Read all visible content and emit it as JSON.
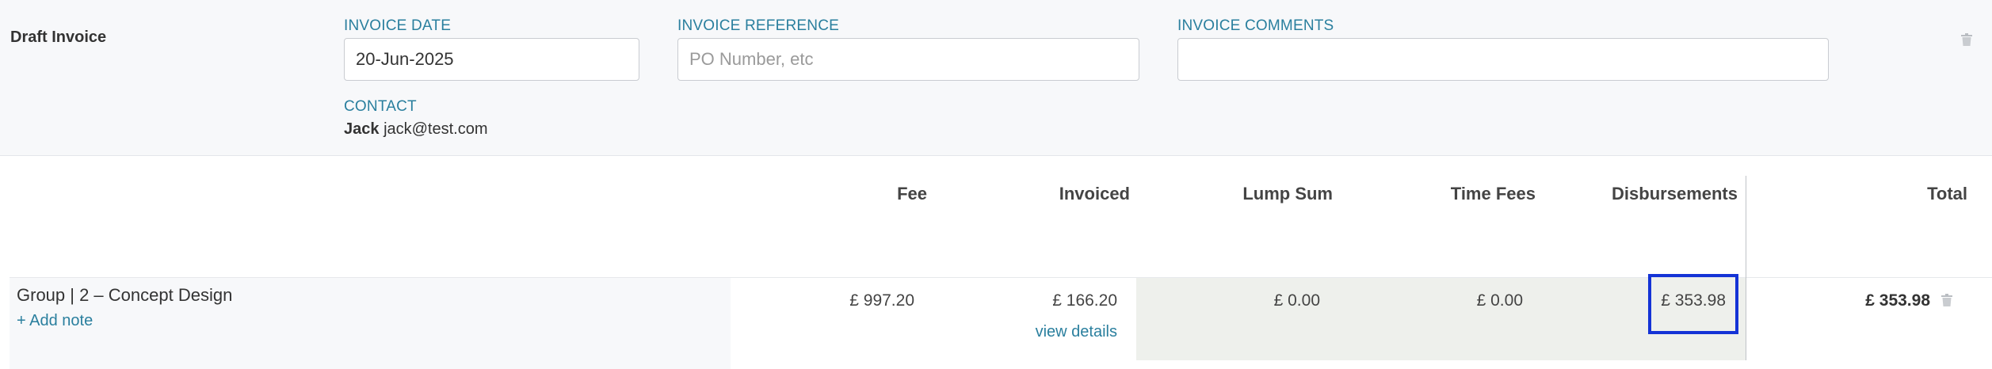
{
  "header": {
    "title": "Draft Invoice",
    "invoice_date_label": "INVOICE DATE",
    "invoice_date_value": "20-Jun-2025",
    "invoice_reference_label": "INVOICE REFERENCE",
    "invoice_reference_placeholder": "PO Number, etc",
    "invoice_comments_label": "INVOICE COMMENTS",
    "invoice_comments_value": "",
    "contact_label": "CONTACT",
    "contact_name": "Jack",
    "contact_email": "jack@test.com",
    "delete_icon": "trash-icon"
  },
  "table": {
    "columns": [
      "Fee",
      "Invoiced",
      "Lump Sum",
      "Time Fees",
      "Disbursements",
      "Total"
    ],
    "rows": [
      {
        "group": "Group | 2 – Concept Design",
        "add_note": "+ Add note",
        "fee": "£ 997.20",
        "invoiced": "£ 166.20",
        "view_details": "view details",
        "lump_sum": "£ 0.00",
        "time_fees": "£ 0.00",
        "disbursements": "£ 353.98",
        "total": "£ 353.98",
        "delete_icon": "trash-icon"
      }
    ]
  },
  "colors": {
    "accent": "#2a7f9e",
    "highlight": "#1433d6",
    "header_bg": "#f7f8fa",
    "cell_bg": "#eef0ec"
  }
}
